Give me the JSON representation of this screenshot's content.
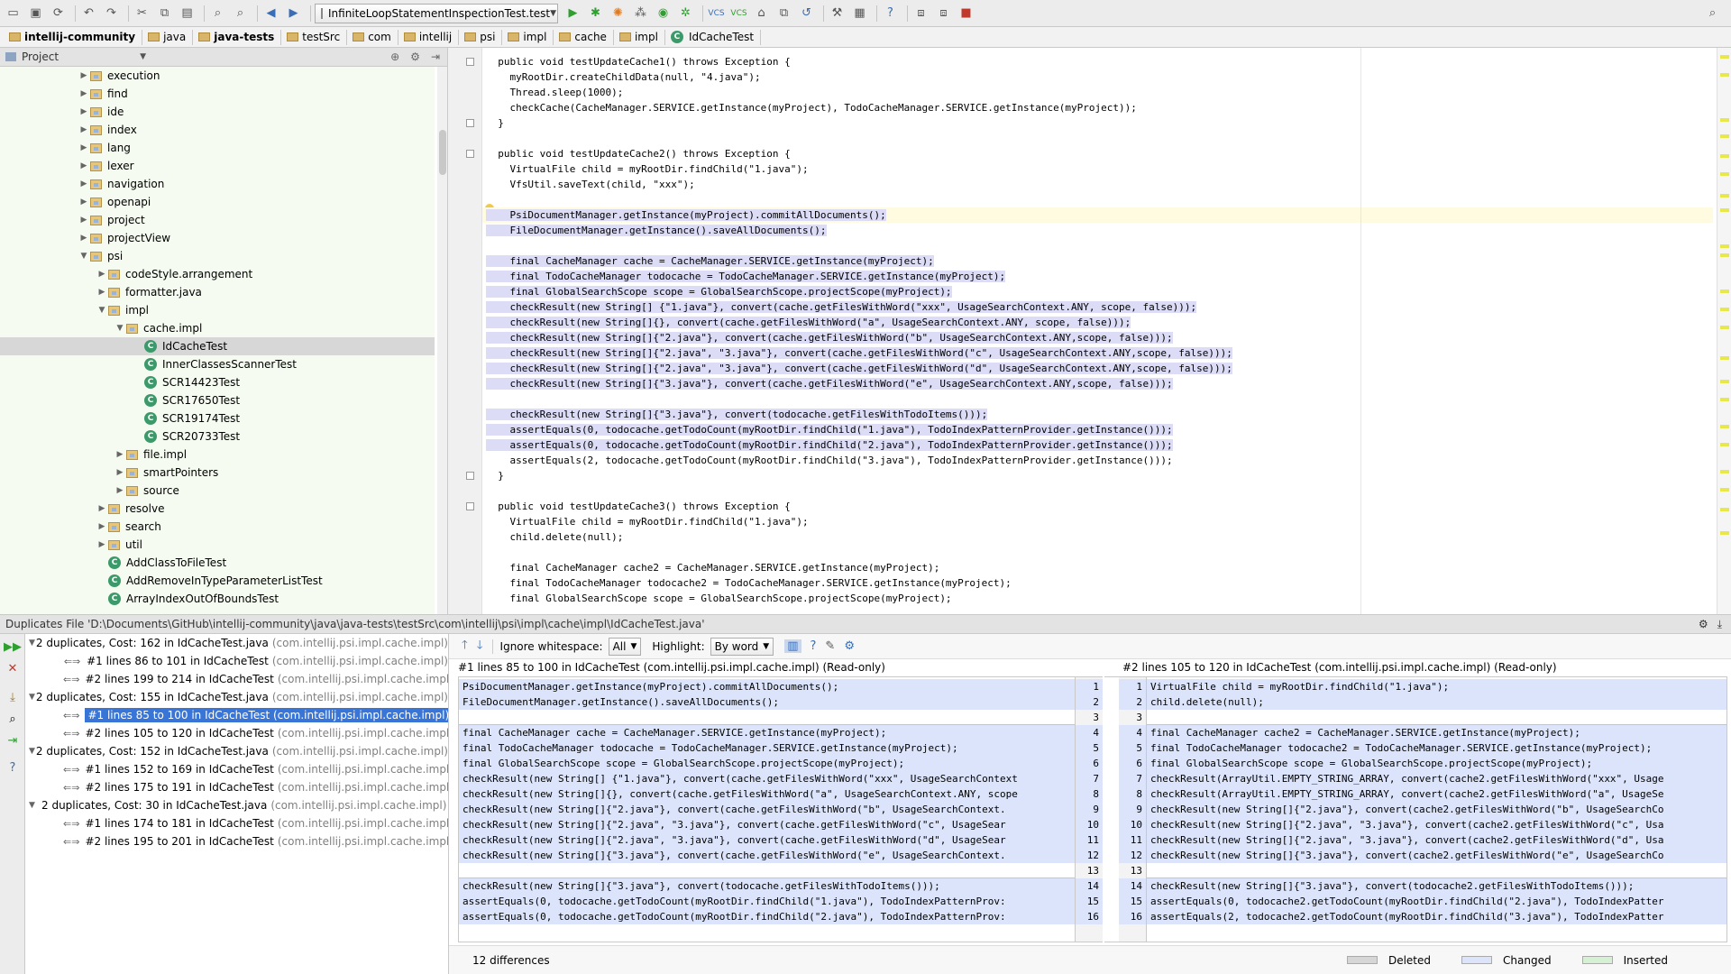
{
  "toolbar": {
    "run_config": "InfiniteLoopStatementInspectionTest.test",
    "icons": [
      "open-icon",
      "save-icon",
      "sync-icon",
      "undo-icon",
      "redo-icon",
      "cut-icon",
      "copy-icon",
      "paste-icon",
      "find-icon",
      "replace-icon",
      "back-icon",
      "forward-icon",
      "run-icon",
      "debug-icon",
      "coverage-icon",
      "profile-icon",
      "build-icon",
      "vcs-update-icon",
      "vcs-commit-icon",
      "search-everywhere-icon"
    ]
  },
  "breadcrumbs": [
    "intellij-community",
    "java",
    "java-tests",
    "testSrc",
    "com",
    "intellij",
    "psi",
    "impl",
    "cache",
    "impl",
    "IdCacheTest"
  ],
  "project": {
    "title": "Project",
    "tree": [
      {
        "label": "execution",
        "indent": 1,
        "type": "folder",
        "arrow": "▶"
      },
      {
        "label": "find",
        "indent": 1,
        "type": "folder",
        "arrow": "▶"
      },
      {
        "label": "ide",
        "indent": 1,
        "type": "folder",
        "arrow": "▶"
      },
      {
        "label": "index",
        "indent": 1,
        "type": "folder",
        "arrow": "▶"
      },
      {
        "label": "lang",
        "indent": 1,
        "type": "folder",
        "arrow": "▶"
      },
      {
        "label": "lexer",
        "indent": 1,
        "type": "folder",
        "arrow": "▶"
      },
      {
        "label": "navigation",
        "indent": 1,
        "type": "folder",
        "arrow": "▶"
      },
      {
        "label": "openapi",
        "indent": 1,
        "type": "folder",
        "arrow": "▶"
      },
      {
        "label": "project",
        "indent": 1,
        "type": "folder",
        "arrow": "▶"
      },
      {
        "label": "projectView",
        "indent": 1,
        "type": "folder",
        "arrow": "▶"
      },
      {
        "label": "psi",
        "indent": 1,
        "type": "folder",
        "arrow": "▼"
      },
      {
        "label": "codeStyle.arrangement",
        "indent": 2,
        "type": "folder",
        "arrow": "▶"
      },
      {
        "label": "formatter.java",
        "indent": 2,
        "type": "folder",
        "arrow": "▶"
      },
      {
        "label": "impl",
        "indent": 2,
        "type": "folder",
        "arrow": "▼"
      },
      {
        "label": "cache.impl",
        "indent": 3,
        "type": "folder",
        "arrow": "▼"
      },
      {
        "label": "IdCacheTest",
        "indent": 4,
        "type": "class",
        "arrow": "",
        "selected": true
      },
      {
        "label": "InnerClassesScannerTest",
        "indent": 4,
        "type": "class",
        "arrow": ""
      },
      {
        "label": "SCR14423Test",
        "indent": 4,
        "type": "class",
        "arrow": ""
      },
      {
        "label": "SCR17650Test",
        "indent": 4,
        "type": "class",
        "arrow": ""
      },
      {
        "label": "SCR19174Test",
        "indent": 4,
        "type": "class",
        "arrow": ""
      },
      {
        "label": "SCR20733Test",
        "indent": 4,
        "type": "class",
        "arrow": ""
      },
      {
        "label": "file.impl",
        "indent": 3,
        "type": "folder",
        "arrow": "▶"
      },
      {
        "label": "smartPointers",
        "indent": 3,
        "type": "folder",
        "arrow": "▶"
      },
      {
        "label": "source",
        "indent": 3,
        "type": "folder",
        "arrow": "▶"
      },
      {
        "label": "resolve",
        "indent": 2,
        "type": "folder",
        "arrow": "▶"
      },
      {
        "label": "search",
        "indent": 2,
        "type": "folder",
        "arrow": "▶"
      },
      {
        "label": "util",
        "indent": 2,
        "type": "folder",
        "arrow": "▶"
      },
      {
        "label": "AddClassToFileTest",
        "indent": 2,
        "type": "class",
        "arrow": ""
      },
      {
        "label": "AddRemoveInTypeParameterListTest",
        "indent": 2,
        "type": "class",
        "arrow": ""
      },
      {
        "label": "ArrayIndexOutOfBoundsTest",
        "indent": 2,
        "type": "class",
        "arrow": ""
      }
    ]
  },
  "editor": {
    "lines": [
      {
        "text": "  public void testUpdateCache1() throws Exception {",
        "hl": false
      },
      {
        "text": "    myRootDir.createChildData(null, \"4.java\");",
        "hl": false
      },
      {
        "text": "    Thread.sleep(1000);",
        "hl": false
      },
      {
        "text": "    checkCache(CacheManager.SERVICE.getInstance(myProject), TodoCacheManager.SERVICE.getInstance(myProject));",
        "hl": false
      },
      {
        "text": "  }",
        "hl": false
      },
      {
        "text": "",
        "hl": false
      },
      {
        "text": "  public void testUpdateCache2() throws Exception {",
        "hl": false
      },
      {
        "text": "    VirtualFile child = myRootDir.findChild(\"1.java\");",
        "hl": false
      },
      {
        "text": "    VfsUtil.saveText(child, \"xxx\");",
        "hl": false
      },
      {
        "text": "",
        "hl": false
      },
      {
        "text": "    PsiDocumentManager.getInstance(myProject).commitAllDocuments();",
        "hl": true,
        "cur": true
      },
      {
        "text": "    FileDocumentManager.getInstance().saveAllDocuments();",
        "hl": true
      },
      {
        "text": "",
        "hl": false
      },
      {
        "text": "    final CacheManager cache = CacheManager.SERVICE.getInstance(myProject);",
        "hl": true
      },
      {
        "text": "    final TodoCacheManager todocache = TodoCacheManager.SERVICE.getInstance(myProject);",
        "hl": true
      },
      {
        "text": "    final GlobalSearchScope scope = GlobalSearchScope.projectScope(myProject);",
        "hl": true
      },
      {
        "text": "    checkResult(new String[] {\"1.java\"}, convert(cache.getFilesWithWord(\"xxx\", UsageSearchContext.ANY, scope, false)));",
        "hl": true
      },
      {
        "text": "    checkResult(new String[]{}, convert(cache.getFilesWithWord(\"a\", UsageSearchContext.ANY, scope, false)));",
        "hl": true
      },
      {
        "text": "    checkResult(new String[]{\"2.java\"}, convert(cache.getFilesWithWord(\"b\", UsageSearchContext.ANY,scope, false)));",
        "hl": true
      },
      {
        "text": "    checkResult(new String[]{\"2.java\", \"3.java\"}, convert(cache.getFilesWithWord(\"c\", UsageSearchContext.ANY,scope, false)));",
        "hl": true
      },
      {
        "text": "    checkResult(new String[]{\"2.java\", \"3.java\"}, convert(cache.getFilesWithWord(\"d\", UsageSearchContext.ANY,scope, false)));",
        "hl": true
      },
      {
        "text": "    checkResult(new String[]{\"3.java\"}, convert(cache.getFilesWithWord(\"e\", UsageSearchContext.ANY,scope, false)));",
        "hl": true
      },
      {
        "text": "",
        "hl": false
      },
      {
        "text": "    checkResult(new String[]{\"3.java\"}, convert(todocache.getFilesWithTodoItems()));",
        "hl": true
      },
      {
        "text": "    assertEquals(0, todocache.getTodoCount(myRootDir.findChild(\"1.java\"), TodoIndexPatternProvider.getInstance()));",
        "hl": true
      },
      {
        "text": "    assertEquals(0, todocache.getTodoCount(myRootDir.findChild(\"2.java\"), TodoIndexPatternProvider.getInstance()));",
        "hl": true
      },
      {
        "text": "    assertEquals(2, todocache.getTodoCount(myRootDir.findChild(\"3.java\"), TodoIndexPatternProvider.getInstance()));",
        "hl": false
      },
      {
        "text": "  }",
        "hl": false
      },
      {
        "text": "",
        "hl": false
      },
      {
        "text": "  public void testUpdateCache3() throws Exception {",
        "hl": false
      },
      {
        "text": "    VirtualFile child = myRootDir.findChild(\"1.java\");",
        "hl": false
      },
      {
        "text": "    child.delete(null);",
        "hl": false
      },
      {
        "text": "",
        "hl": false
      },
      {
        "text": "    final CacheManager cache2 = CacheManager.SERVICE.getInstance(myProject);",
        "hl": false
      },
      {
        "text": "    final TodoCacheManager todocache2 = TodoCacheManager.SERVICE.getInstance(myProject);",
        "hl": false
      },
      {
        "text": "    final GlobalSearchScope scope = GlobalSearchScope.projectScope(myProject);",
        "hl": false
      }
    ]
  },
  "duplicates": {
    "header": "Duplicates File 'D:\\Documents\\GitHub\\intellij-community\\java\\java-tests\\testSrc\\com\\intellij\\psi\\impl\\cache\\impl\\IdCacheTest.java'",
    "rows": [
      {
        "kind": "group",
        "text": "2 duplicates, Cost: 162 in IdCacheTest.java",
        "pkg": "(com.intellij.psi.impl.cache.impl)"
      },
      {
        "kind": "item",
        "text": "#1 lines 86 to 101 in IdCacheTest",
        "pkg": "(com.intellij.psi.impl.cache.impl)"
      },
      {
        "kind": "item",
        "text": "#2 lines 199 to 214 in IdCacheTest",
        "pkg": "(com.intellij.psi.impl.cache.impl)"
      },
      {
        "kind": "group",
        "text": "2 duplicates, Cost: 155 in IdCacheTest.java",
        "pkg": "(com.intellij.psi.impl.cache.impl)"
      },
      {
        "kind": "item",
        "text": "#1 lines 85 to 100 in IdCacheTest (com.intellij.psi.impl.cache.impl)",
        "pkg": "",
        "selected": true
      },
      {
        "kind": "item",
        "text": "#2 lines 105 to 120 in IdCacheTest",
        "pkg": "(com.intellij.psi.impl.cache.impl)"
      },
      {
        "kind": "group",
        "text": "2 duplicates, Cost: 152 in IdCacheTest.java",
        "pkg": "(com.intellij.psi.impl.cache.impl)"
      },
      {
        "kind": "item",
        "text": "#1 lines 152 to 169 in IdCacheTest",
        "pkg": "(com.intellij.psi.impl.cache.impl)"
      },
      {
        "kind": "item",
        "text": "#2 lines 175 to 191 in IdCacheTest",
        "pkg": "(com.intellij.psi.impl.cache.impl)"
      },
      {
        "kind": "group",
        "text": "2 duplicates, Cost: 30 in IdCacheTest.java",
        "pkg": "(com.intellij.psi.impl.cache.impl)"
      },
      {
        "kind": "item",
        "text": "#1 lines 174 to 181 in IdCacheTest",
        "pkg": "(com.intellij.psi.impl.cache.impl)"
      },
      {
        "kind": "item",
        "text": "#2 lines 195 to 201 in IdCacheTest",
        "pkg": "(com.intellij.psi.impl.cache.impl)"
      }
    ]
  },
  "diff": {
    "ignore_whitespace_label": "Ignore whitespace:",
    "ignore_whitespace_value": "All",
    "highlight_label": "Highlight:",
    "highlight_value": "By word",
    "left_title": "#1 lines 85 to 100 in IdCacheTest (com.intellij.psi.impl.cache.impl) (Read-only)",
    "right_title": "#2 lines 105 to 120 in IdCacheTest (com.intellij.psi.impl.cache.impl) (Read-only)",
    "left_lines": [
      {
        "n": "1",
        "text": "PsiDocumentManager.getInstance(myProject).commitAllDocuments();",
        "ch": true
      },
      {
        "n": "2",
        "text": "FileDocumentManager.getInstance().saveAllDocuments();",
        "ch": true
      },
      {
        "n": "3",
        "text": "",
        "ch": false
      },
      {
        "n": "4",
        "text": "final CacheManager cache = CacheManager.SERVICE.getInstance(myProject);",
        "ch": true
      },
      {
        "n": "5",
        "text": "final TodoCacheManager todocache = TodoCacheManager.SERVICE.getInstance(myProject);",
        "ch": true
      },
      {
        "n": "6",
        "text": "final GlobalSearchScope scope = GlobalSearchScope.projectScope(myProject);",
        "ch": true
      },
      {
        "n": "7",
        "text": "checkResult(new String[] {\"1.java\"}, convert(cache.getFilesWithWord(\"xxx\", UsageSearchContext",
        "ch": true
      },
      {
        "n": "8",
        "text": "checkResult(new String[]{}, convert(cache.getFilesWithWord(\"a\", UsageSearchContext.ANY, scope",
        "ch": true
      },
      {
        "n": "9",
        "text": "checkResult(new String[]{\"2.java\"}, convert(cache.getFilesWithWord(\"b\", UsageSearchContext.",
        "ch": true
      },
      {
        "n": "10",
        "text": "checkResult(new String[]{\"2.java\", \"3.java\"}, convert(cache.getFilesWithWord(\"c\", UsageSear",
        "ch": true
      },
      {
        "n": "11",
        "text": "checkResult(new String[]{\"2.java\", \"3.java\"}, convert(cache.getFilesWithWord(\"d\", UsageSear",
        "ch": true
      },
      {
        "n": "12",
        "text": "checkResult(new String[]{\"3.java\"}, convert(cache.getFilesWithWord(\"e\", UsageSearchContext.",
        "ch": true
      },
      {
        "n": "13",
        "text": "",
        "ch": false
      },
      {
        "n": "14",
        "text": "checkResult(new String[]{\"3.java\"}, convert(todocache.getFilesWithTodoItems()));",
        "ch": true
      },
      {
        "n": "15",
        "text": "assertEquals(0, todocache.getTodoCount(myRootDir.findChild(\"1.java\"), TodoIndexPatternProv:",
        "ch": true
      },
      {
        "n": "16",
        "text": "assertEquals(0, todocache.getTodoCount(myRootDir.findChild(\"2.java\"), TodoIndexPatternProv:",
        "ch": true
      }
    ],
    "right_lines": [
      {
        "n": "1",
        "text": "VirtualFile child = myRootDir.findChild(\"1.java\");",
        "ch": true
      },
      {
        "n": "2",
        "text": "child.delete(null);",
        "ch": true
      },
      {
        "n": "3",
        "text": "",
        "ch": false
      },
      {
        "n": "4",
        "text": "final CacheManager cache2 = CacheManager.SERVICE.getInstance(myProject);",
        "ch": true
      },
      {
        "n": "5",
        "text": "final TodoCacheManager todocache2 = TodoCacheManager.SERVICE.getInstance(myProject);",
        "ch": true
      },
      {
        "n": "6",
        "text": "final GlobalSearchScope scope = GlobalSearchScope.projectScope(myProject);",
        "ch": true
      },
      {
        "n": "7",
        "text": "checkResult(ArrayUtil.EMPTY_STRING_ARRAY, convert(cache2.getFilesWithWord(\"xxx\", Usage",
        "ch": true
      },
      {
        "n": "8",
        "text": "checkResult(ArrayUtil.EMPTY_STRING_ARRAY, convert(cache2.getFilesWithWord(\"a\", UsageSe",
        "ch": true
      },
      {
        "n": "9",
        "text": "checkResult(new String[]{\"2.java\"}, convert(cache2.getFilesWithWord(\"b\", UsageSearchCo",
        "ch": true
      },
      {
        "n": "10",
        "text": "checkResult(new String[]{\"2.java\", \"3.java\"}, convert(cache2.getFilesWithWord(\"c\", Usa",
        "ch": true
      },
      {
        "n": "11",
        "text": "checkResult(new String[]{\"2.java\", \"3.java\"}, convert(cache2.getFilesWithWord(\"d\", Usa",
        "ch": true
      },
      {
        "n": "12",
        "text": "checkResult(new String[]{\"3.java\"}, convert(cache2.getFilesWithWord(\"e\", UsageSearchCo",
        "ch": true
      },
      {
        "n": "13",
        "text": "",
        "ch": false
      },
      {
        "n": "14",
        "text": "checkResult(new String[]{\"3.java\"}, convert(todocache2.getFilesWithTodoItems()));",
        "ch": true
      },
      {
        "n": "15",
        "text": "assertEquals(0, todocache2.getTodoCount(myRootDir.findChild(\"2.java\"), TodoIndexPatter",
        "ch": true
      },
      {
        "n": "16",
        "text": "assertEquals(2, todocache2.getTodoCount(myRootDir.findChild(\"3.java\"), TodoIndexPatter",
        "ch": true
      }
    ],
    "status": "12 differences",
    "legend": [
      {
        "label": "Deleted",
        "color": "#d6d6d6"
      },
      {
        "label": "Changed",
        "color": "#dbe4fa"
      },
      {
        "label": "Inserted",
        "color": "#d6f0d4"
      }
    ]
  }
}
